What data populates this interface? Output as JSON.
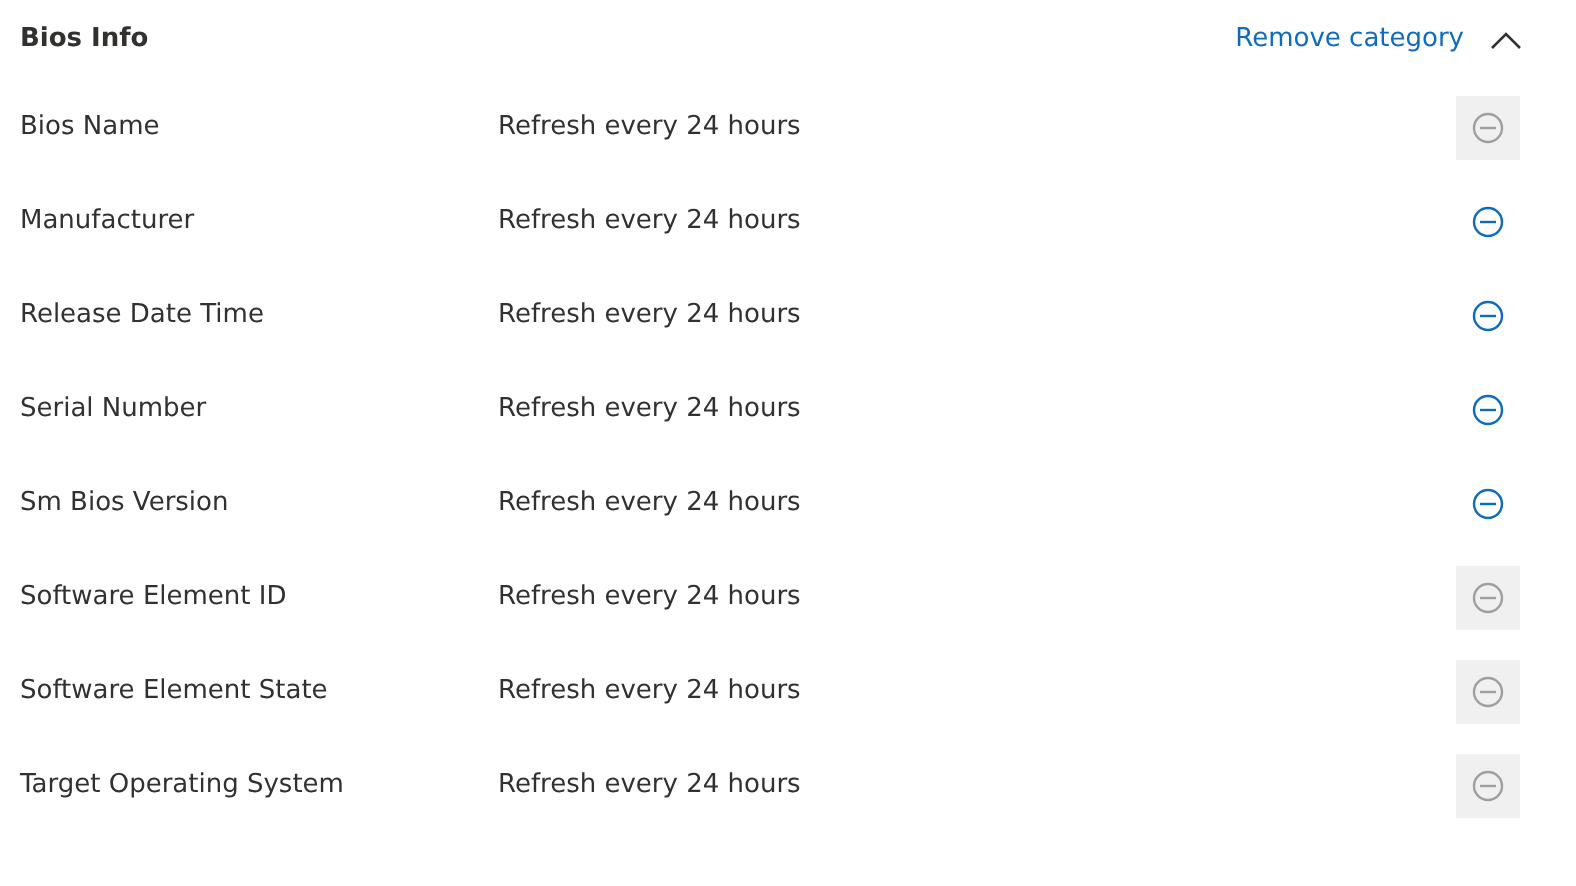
{
  "category": {
    "title": "Bios Info",
    "remove_label": "Remove category",
    "expanded": true
  },
  "rows": [
    {
      "name": "Bios Name",
      "refresh": "Refresh every 24 hours",
      "disabled": true
    },
    {
      "name": "Manufacturer",
      "refresh": "Refresh every 24 hours",
      "disabled": false
    },
    {
      "name": "Release Date Time",
      "refresh": "Refresh every 24 hours",
      "disabled": false
    },
    {
      "name": "Serial Number",
      "refresh": "Refresh every 24 hours",
      "disabled": false
    },
    {
      "name": "Sm Bios Version",
      "refresh": "Refresh every 24 hours",
      "disabled": false
    },
    {
      "name": "Software Element ID",
      "refresh": "Refresh every 24 hours",
      "disabled": true
    },
    {
      "name": "Software Element State",
      "refresh": "Refresh every 24 hours",
      "disabled": true
    },
    {
      "name": "Target Operating System",
      "refresh": "Refresh every 24 hours",
      "disabled": true
    }
  ]
}
